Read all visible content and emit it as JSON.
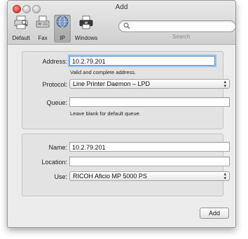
{
  "window": {
    "title": "Add"
  },
  "toolbar": {
    "items": [
      {
        "label": "Default",
        "icon": "default-printer-icon",
        "selected": false
      },
      {
        "label": "Fax",
        "icon": "fax-icon",
        "selected": false
      },
      {
        "label": "IP",
        "icon": "ip-globe-icon",
        "selected": true
      },
      {
        "label": "Windows",
        "icon": "windows-printer-icon",
        "selected": false
      }
    ]
  },
  "search": {
    "value": "",
    "label": "Search"
  },
  "form1": {
    "address_label": "Address:",
    "address_value": "10.2.79.201",
    "address_hint": "Valid and complete address.",
    "protocol_label": "Protocol:",
    "protocol_value": "Line Printer Daemon – LPD",
    "queue_label": "Queue:",
    "queue_value": "",
    "queue_hint": "Leave blank for default queue."
  },
  "form2": {
    "name_label": "Name:",
    "name_value": "10.2.79.201",
    "location_label": "Location:",
    "location_value": "",
    "use_label": "Use:",
    "use_value": "RICOH Aficio MP 5000 PS"
  },
  "actions": {
    "add_label": "Add"
  },
  "colors": {
    "focus": "#5a92d8",
    "close": "#e0443e"
  }
}
